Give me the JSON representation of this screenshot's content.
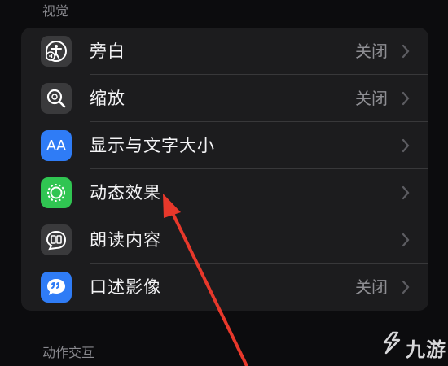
{
  "sections": {
    "vision_title": "视觉",
    "interaction_title": "动作交互"
  },
  "rows": [
    {
      "label": "旁白",
      "value": "关闭",
      "icon": "voiceover-icon",
      "icon_bg": "#3a3a3c"
    },
    {
      "label": "缩放",
      "value": "关闭",
      "icon": "zoom-icon",
      "icon_bg": "#3a3a3c"
    },
    {
      "label": "显示与文字大小",
      "value": "",
      "icon": "text-size-icon",
      "icon_bg": "#2f7cf6"
    },
    {
      "label": "动态效果",
      "value": "",
      "icon": "motion-icon",
      "icon_bg": "#30c552"
    },
    {
      "label": "朗读内容",
      "value": "",
      "icon": "spoken-content-icon",
      "icon_bg": "#3a3a3c"
    },
    {
      "label": "口述影像",
      "value": "关闭",
      "icon": "audio-description-icon",
      "icon_bg": "#2f7cf6"
    }
  ],
  "icon_text": {
    "text_size": "AA"
  },
  "annotation": {
    "arrow_color": "#e8382b"
  },
  "watermark": {
    "text": "九游"
  }
}
